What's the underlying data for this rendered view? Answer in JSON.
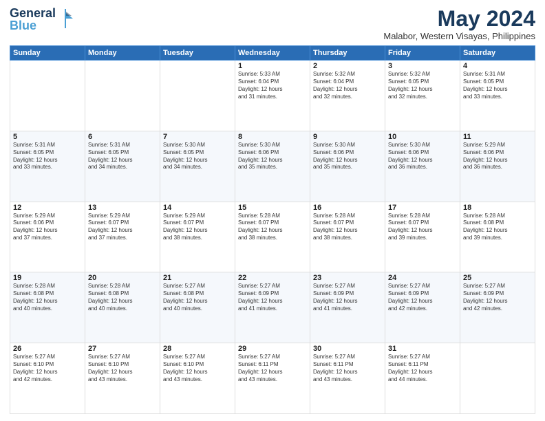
{
  "header": {
    "logo_line1": "General",
    "logo_line2": "Blue",
    "main_title": "May 2024",
    "subtitle": "Malabor, Western Visayas, Philippines"
  },
  "days_of_week": [
    "Sunday",
    "Monday",
    "Tuesday",
    "Wednesday",
    "Thursday",
    "Friday",
    "Saturday"
  ],
  "weeks": [
    [
      {
        "day": "",
        "info": ""
      },
      {
        "day": "",
        "info": ""
      },
      {
        "day": "",
        "info": ""
      },
      {
        "day": "1",
        "info": "Sunrise: 5:33 AM\nSunset: 6:04 PM\nDaylight: 12 hours\nand 31 minutes."
      },
      {
        "day": "2",
        "info": "Sunrise: 5:32 AM\nSunset: 6:04 PM\nDaylight: 12 hours\nand 32 minutes."
      },
      {
        "day": "3",
        "info": "Sunrise: 5:32 AM\nSunset: 6:05 PM\nDaylight: 12 hours\nand 32 minutes."
      },
      {
        "day": "4",
        "info": "Sunrise: 5:31 AM\nSunset: 6:05 PM\nDaylight: 12 hours\nand 33 minutes."
      }
    ],
    [
      {
        "day": "5",
        "info": "Sunrise: 5:31 AM\nSunset: 6:05 PM\nDaylight: 12 hours\nand 33 minutes."
      },
      {
        "day": "6",
        "info": "Sunrise: 5:31 AM\nSunset: 6:05 PM\nDaylight: 12 hours\nand 34 minutes."
      },
      {
        "day": "7",
        "info": "Sunrise: 5:30 AM\nSunset: 6:05 PM\nDaylight: 12 hours\nand 34 minutes."
      },
      {
        "day": "8",
        "info": "Sunrise: 5:30 AM\nSunset: 6:06 PM\nDaylight: 12 hours\nand 35 minutes."
      },
      {
        "day": "9",
        "info": "Sunrise: 5:30 AM\nSunset: 6:06 PM\nDaylight: 12 hours\nand 35 minutes."
      },
      {
        "day": "10",
        "info": "Sunrise: 5:30 AM\nSunset: 6:06 PM\nDaylight: 12 hours\nand 36 minutes."
      },
      {
        "day": "11",
        "info": "Sunrise: 5:29 AM\nSunset: 6:06 PM\nDaylight: 12 hours\nand 36 minutes."
      }
    ],
    [
      {
        "day": "12",
        "info": "Sunrise: 5:29 AM\nSunset: 6:06 PM\nDaylight: 12 hours\nand 37 minutes."
      },
      {
        "day": "13",
        "info": "Sunrise: 5:29 AM\nSunset: 6:07 PM\nDaylight: 12 hours\nand 37 minutes."
      },
      {
        "day": "14",
        "info": "Sunrise: 5:29 AM\nSunset: 6:07 PM\nDaylight: 12 hours\nand 38 minutes."
      },
      {
        "day": "15",
        "info": "Sunrise: 5:28 AM\nSunset: 6:07 PM\nDaylight: 12 hours\nand 38 minutes."
      },
      {
        "day": "16",
        "info": "Sunrise: 5:28 AM\nSunset: 6:07 PM\nDaylight: 12 hours\nand 38 minutes."
      },
      {
        "day": "17",
        "info": "Sunrise: 5:28 AM\nSunset: 6:07 PM\nDaylight: 12 hours\nand 39 minutes."
      },
      {
        "day": "18",
        "info": "Sunrise: 5:28 AM\nSunset: 6:08 PM\nDaylight: 12 hours\nand 39 minutes."
      }
    ],
    [
      {
        "day": "19",
        "info": "Sunrise: 5:28 AM\nSunset: 6:08 PM\nDaylight: 12 hours\nand 40 minutes."
      },
      {
        "day": "20",
        "info": "Sunrise: 5:28 AM\nSunset: 6:08 PM\nDaylight: 12 hours\nand 40 minutes."
      },
      {
        "day": "21",
        "info": "Sunrise: 5:27 AM\nSunset: 6:08 PM\nDaylight: 12 hours\nand 40 minutes."
      },
      {
        "day": "22",
        "info": "Sunrise: 5:27 AM\nSunset: 6:09 PM\nDaylight: 12 hours\nand 41 minutes."
      },
      {
        "day": "23",
        "info": "Sunrise: 5:27 AM\nSunset: 6:09 PM\nDaylight: 12 hours\nand 41 minutes."
      },
      {
        "day": "24",
        "info": "Sunrise: 5:27 AM\nSunset: 6:09 PM\nDaylight: 12 hours\nand 42 minutes."
      },
      {
        "day": "25",
        "info": "Sunrise: 5:27 AM\nSunset: 6:09 PM\nDaylight: 12 hours\nand 42 minutes."
      }
    ],
    [
      {
        "day": "26",
        "info": "Sunrise: 5:27 AM\nSunset: 6:10 PM\nDaylight: 12 hours\nand 42 minutes."
      },
      {
        "day": "27",
        "info": "Sunrise: 5:27 AM\nSunset: 6:10 PM\nDaylight: 12 hours\nand 43 minutes."
      },
      {
        "day": "28",
        "info": "Sunrise: 5:27 AM\nSunset: 6:10 PM\nDaylight: 12 hours\nand 43 minutes."
      },
      {
        "day": "29",
        "info": "Sunrise: 5:27 AM\nSunset: 6:11 PM\nDaylight: 12 hours\nand 43 minutes."
      },
      {
        "day": "30",
        "info": "Sunrise: 5:27 AM\nSunset: 6:11 PM\nDaylight: 12 hours\nand 43 minutes."
      },
      {
        "day": "31",
        "info": "Sunrise: 5:27 AM\nSunset: 6:11 PM\nDaylight: 12 hours\nand 44 minutes."
      },
      {
        "day": "",
        "info": ""
      }
    ]
  ]
}
